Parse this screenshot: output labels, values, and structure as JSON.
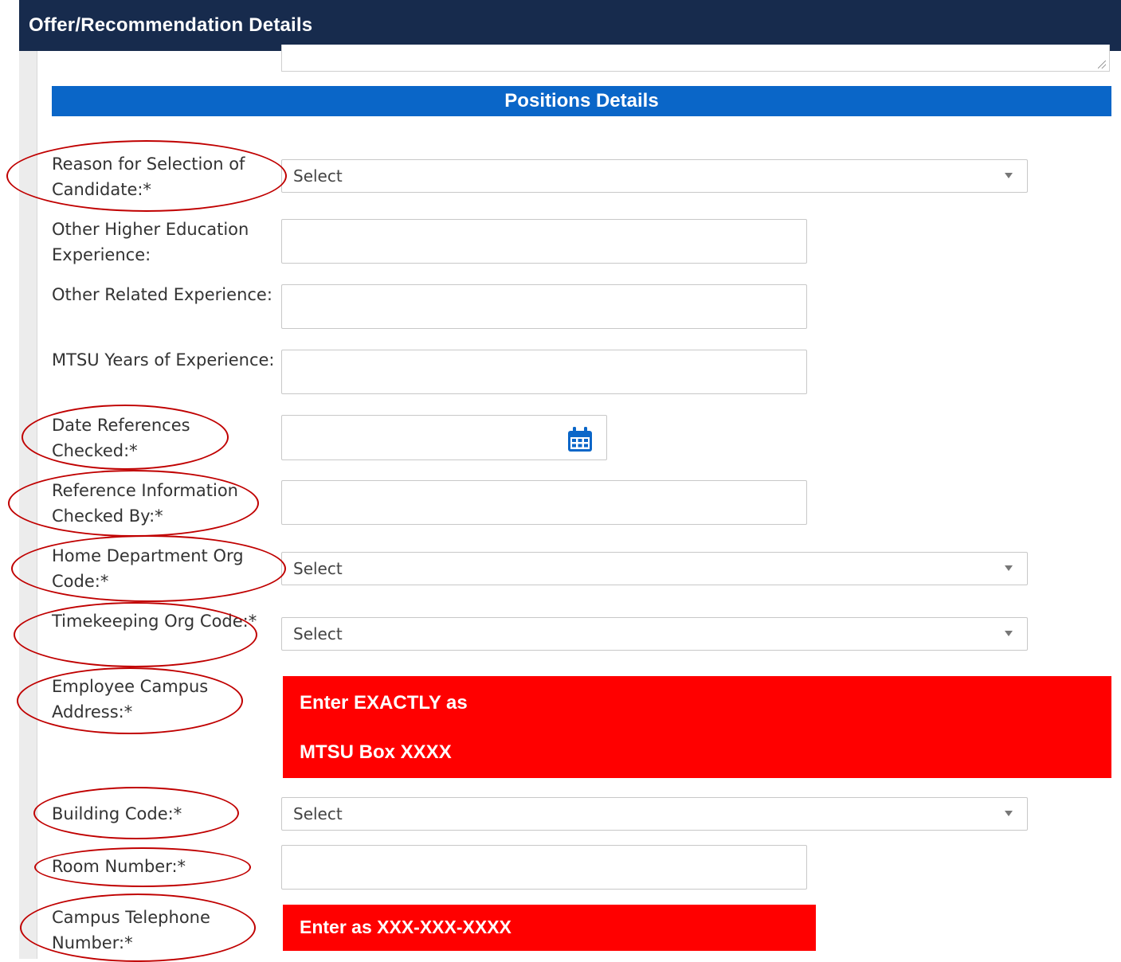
{
  "header": {
    "title": "Offer/Recommendation Details"
  },
  "section": {
    "title": "Positions Details"
  },
  "fields": {
    "reason_selection": {
      "label": "Reason for Selection of Candidate:*",
      "value": "Select"
    },
    "other_higher_ed": {
      "label": "Other Higher Education Experience:",
      "value": ""
    },
    "other_related": {
      "label": "Other Related Experience:",
      "value": ""
    },
    "mtsu_years": {
      "label": "MTSU Years of Experience:",
      "value": ""
    },
    "date_references": {
      "label": "Date References Checked:*",
      "value": ""
    },
    "reference_checked_by": {
      "label": "Reference Information Checked By:*",
      "value": ""
    },
    "home_dept_org": {
      "label": "Home Department Org Code:*",
      "value": "Select"
    },
    "timekeeping_org": {
      "label": "Timekeeping Org Code:*",
      "value": "Select"
    },
    "campus_address": {
      "label": "Employee Campus Address:*"
    },
    "building_code": {
      "label": "Building Code:*",
      "value": "Select"
    },
    "room_number": {
      "label": "Room Number:*",
      "value": ""
    },
    "campus_phone": {
      "label": "Campus Telephone Number:*"
    }
  },
  "annotations": {
    "address_note_line1": "Enter EXACTLY as",
    "address_note_line2": "MTSU Box XXXX",
    "phone_note": "Enter as XXX-XXX-XXXX",
    "highlight_color": "#c00000",
    "note_color": "#ff0000"
  },
  "icons": {
    "date_picker": "calendar-icon",
    "dropdown": "caret-down-icon"
  },
  "colors": {
    "header_bg": "#172b4d",
    "section_bg": "#0a66c8"
  }
}
